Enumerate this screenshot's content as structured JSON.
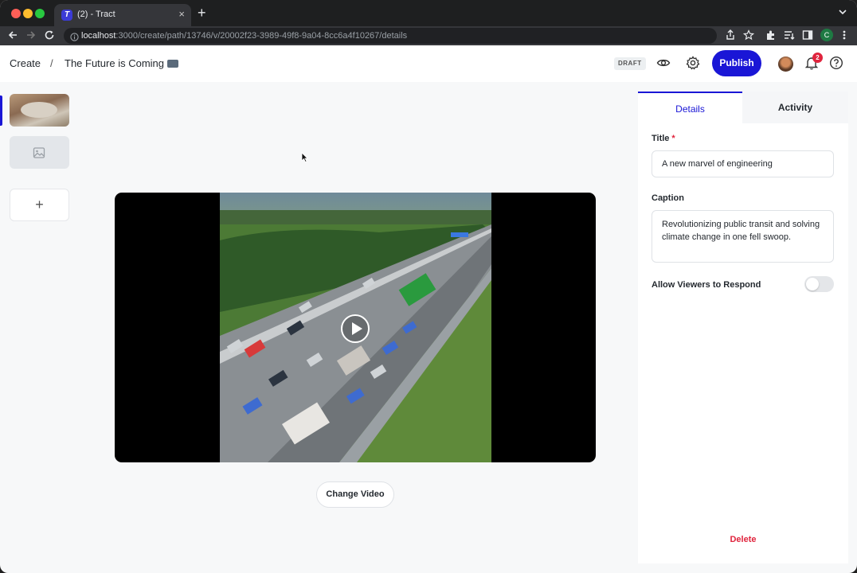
{
  "browser": {
    "tab_title": "(2) - Tract",
    "tab_favicon": "T",
    "url_host": "localhost",
    "url_rest": ":3000/create/path/13746/v/20002f23-3989-49f8-9a04-8cc6a4f10267/details",
    "profile_initial": "C"
  },
  "header": {
    "breadcrumb_root": "Create",
    "breadcrumb_separator": "/",
    "story_title": "The Future is Coming",
    "status_badge": "DRAFT",
    "publish_label": "Publish",
    "notification_count": "2",
    "accent_color": "#1a16d6"
  },
  "sidebar": {
    "slides": [
      {
        "kind": "video-thumbnail",
        "active": true
      },
      {
        "kind": "image-placeholder",
        "icon": "image-icon",
        "active": false
      }
    ],
    "add_label": "+"
  },
  "main": {
    "video_state": "paused",
    "change_video_label": "Change Video"
  },
  "panel": {
    "tabs": [
      {
        "label": "Details",
        "active": true
      },
      {
        "label": "Activity",
        "active": false
      }
    ],
    "title_label": "Title",
    "title_required_mark": "*",
    "title_value": "A new marvel of engineering",
    "caption_label": "Caption",
    "caption_value": "Revolutionizing public transit and solving climate change in one fell swoop.",
    "allow_respond_label": "Allow Viewers to Respond",
    "allow_respond_enabled": false,
    "delete_label": "Delete",
    "danger_color": "#e0243d"
  }
}
